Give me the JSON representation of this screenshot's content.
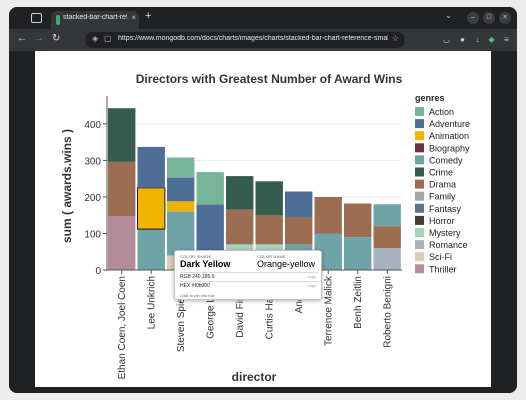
{
  "browser": {
    "tab_title": "stacked-bar-chart-reference-",
    "new_tab": "+",
    "close": "×",
    "url": "https://www.mongodb.com/docs/charts/images/charts/stacked-bar-chart-reference-small.png",
    "back": "←",
    "forward": "→",
    "reload": "↻",
    "min": "–",
    "max": "□",
    "close_win": "×",
    "tabs_menu": "⌄",
    "menu": "≡"
  },
  "chart_data": {
    "type": "bar",
    "stacked": true,
    "title": "Directors with Greatest Number of Award Wins",
    "xlabel": "director",
    "ylabel": "sum ( awards.wins )",
    "ylim": [
      0,
      460
    ],
    "yticks": [
      "0",
      "100",
      "200",
      "300",
      "400"
    ],
    "legend_title": "genres",
    "legend_position": "right",
    "categories": [
      "Ethan Coen, Joel Coen",
      "Lee Unkrich",
      "Steven Spielberg",
      "George Lucas",
      "David Fincher",
      "Curtis Hanson",
      "Ang Lee",
      "Terrence Malick",
      "Benh Zeitlin",
      "Roberto Benigni"
    ],
    "series": [
      {
        "name": "Action",
        "color": "#76b597",
        "values": [
          0,
          0,
          0,
          0,
          0,
          0,
          0,
          0,
          0,
          0
        ]
      },
      {
        "name": "Adventure",
        "color": "#4e6e98",
        "values": [
          0,
          0,
          0,
          0,
          0,
          0,
          0,
          0,
          0,
          0
        ]
      },
      {
        "name": "Animation",
        "color": "#f0b400",
        "values": [
          0,
          0,
          0,
          0,
          0,
          0,
          0,
          0,
          0,
          0
        ]
      },
      {
        "name": "Biography",
        "color": "#6d2f43",
        "values": [
          0,
          0,
          0,
          0,
          0,
          0,
          0,
          0,
          0,
          0
        ]
      },
      {
        "name": "Comedy",
        "color": "#6ea3a8",
        "values": [
          0,
          0,
          0,
          0,
          0,
          0,
          0,
          0,
          0,
          0
        ]
      },
      {
        "name": "Crime",
        "color": "#355c4f",
        "values": [
          0,
          0,
          0,
          0,
          0,
          0,
          0,
          0,
          0,
          0
        ]
      },
      {
        "name": "Drama",
        "color": "#9c6d50",
        "values": [
          0,
          0,
          0,
          0,
          0,
          0,
          0,
          0,
          0,
          0
        ]
      },
      {
        "name": "Family",
        "color": "#a6a3a4",
        "values": [
          0,
          0,
          0,
          0,
          0,
          0,
          0,
          0,
          0,
          0
        ]
      },
      {
        "name": "Fantasy",
        "color": "#5d7487",
        "values": [
          0,
          0,
          0,
          0,
          0,
          0,
          0,
          0,
          0,
          0
        ]
      },
      {
        "name": "Horror",
        "color": "#4a3a35",
        "values": [
          0,
          0,
          0,
          0,
          0,
          0,
          0,
          0,
          0,
          0
        ]
      },
      {
        "name": "Mystery",
        "color": "#a5d3bd",
        "values": [
          0,
          0,
          0,
          0,
          0,
          0,
          0,
          0,
          0,
          0
        ]
      },
      {
        "name": "Romance",
        "color": "#a4b3bd",
        "values": [
          0,
          0,
          0,
          0,
          0,
          0,
          0,
          0,
          0,
          0
        ]
      },
      {
        "name": "Sci-Fi",
        "color": "#d9ceb7",
        "values": [
          0,
          0,
          0,
          0,
          0,
          0,
          0,
          0,
          0,
          0
        ]
      },
      {
        "name": "Thriller",
        "color": "#b38b99",
        "values": [
          0,
          0,
          0,
          0,
          0,
          0,
          0,
          0,
          0,
          0
        ]
      }
    ],
    "stacks": [
      [
        {
          "genre": "Thriller",
          "value": 148
        },
        {
          "genre": "Drama",
          "value": 148
        },
        {
          "genre": "Crime",
          "value": 147
        }
      ],
      [
        {
          "genre": "Comedy",
          "value": 112
        },
        {
          "genre": "Animation",
          "value": 113
        },
        {
          "genre": "Adventure",
          "value": 112
        }
      ],
      [
        {
          "genre": "Sci-Fi",
          "value": 40
        },
        {
          "genre": "Comedy",
          "value": 120
        },
        {
          "genre": "Animation",
          "value": 28
        },
        {
          "genre": "Adventure",
          "value": 65
        },
        {
          "genre": "Action",
          "value": 55
        }
      ],
      [
        {
          "genre": "Fantasy",
          "value": 40
        },
        {
          "genre": "Adventure",
          "value": 140
        },
        {
          "genre": "Action",
          "value": 88
        }
      ],
      [
        {
          "genre": "Mystery",
          "value": 70
        },
        {
          "genre": "Drama",
          "value": 95
        },
        {
          "genre": "Crime",
          "value": 92
        }
      ],
      [
        {
          "genre": "Mystery",
          "value": 70
        },
        {
          "genre": "Drama",
          "value": 80
        },
        {
          "genre": "Crime",
          "value": 93
        }
      ],
      [
        {
          "genre": "Comedy",
          "value": 70
        },
        {
          "genre": "Drama",
          "value": 75
        },
        {
          "genre": "Adventure",
          "value": 70
        }
      ],
      [
        {
          "genre": "Comedy",
          "value": 100
        },
        {
          "genre": "Drama",
          "value": 100
        }
      ],
      [
        {
          "genre": "Comedy",
          "value": 90
        },
        {
          "genre": "Drama",
          "value": 92
        }
      ],
      [
        {
          "genre": "Romance",
          "value": 60
        },
        {
          "genre": "Drama",
          "value": 60
        },
        {
          "genre": "Comedy",
          "value": 60
        }
      ]
    ]
  },
  "tooltip": {
    "shade_label": "COLOR SHADE",
    "shade_value": "Dark Yellow",
    "name_label": "COLOR NAME",
    "name_value": "Orange-yellow",
    "rgb": "RGB   240,185,0",
    "hex": "HEX   #f0b900",
    "copy": "copy",
    "footer": "Click to pin info box"
  }
}
